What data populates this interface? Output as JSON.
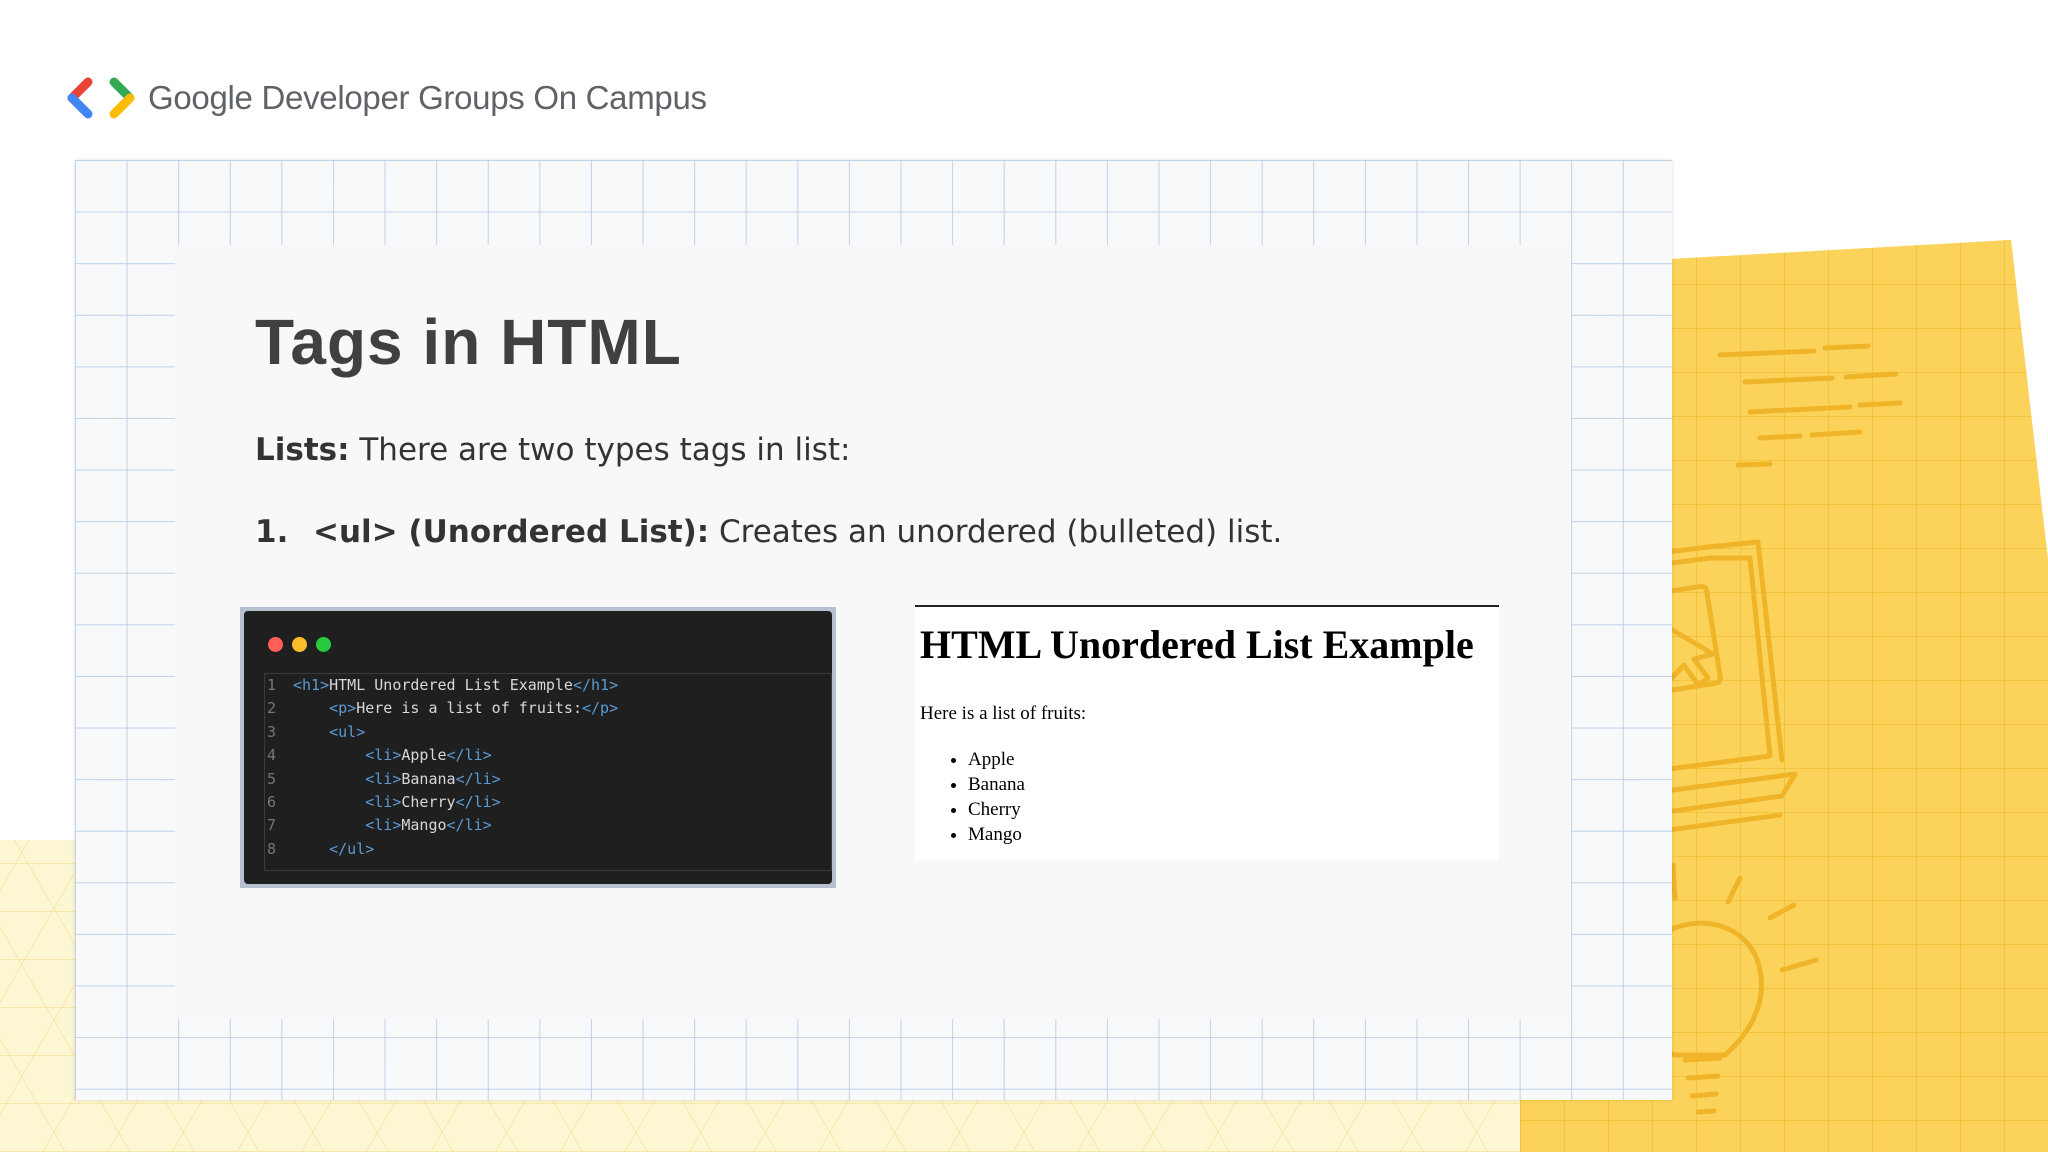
{
  "brand": {
    "name": "Google Developer Groups On Campus",
    "logo_colors": [
      "#ea4335",
      "#4285f4",
      "#34a853",
      "#fbbc04"
    ],
    "logo_icon": "gdg-chevrons-icon"
  },
  "slide": {
    "title": "Tags in HTML",
    "lists_label": "Lists:",
    "lists_text": " There are two types tags in list:",
    "item_number": "1.",
    "item_tag": "<ul> (Unordered List):",
    "item_text": " Creates an unordered (bulleted) list."
  },
  "code_window": {
    "dot_colors": [
      "#ff5f56",
      "#ffbd2e",
      "#27c93f"
    ],
    "lines": [
      {
        "n": "1",
        "indent": "",
        "open": "<h1>",
        "text": "HTML Unordered List Example",
        "close": "</h1>"
      },
      {
        "n": "2",
        "indent": "    ",
        "open": "<p>",
        "text": "Here is a list of fruits:",
        "close": "</p>"
      },
      {
        "n": "3",
        "indent": "    ",
        "open": "<ul>",
        "text": "",
        "close": ""
      },
      {
        "n": "4",
        "indent": "        ",
        "open": "<li>",
        "text": "Apple",
        "close": "</li>"
      },
      {
        "n": "5",
        "indent": "        ",
        "open": "<li>",
        "text": "Banana",
        "close": "</li>"
      },
      {
        "n": "6",
        "indent": "        ",
        "open": "<li>",
        "text": "Cherry",
        "close": "</li>"
      },
      {
        "n": "7",
        "indent": "        ",
        "open": "<li>",
        "text": "Mango",
        "close": "</li>"
      },
      {
        "n": "8",
        "indent": "    ",
        "open": "</ul>",
        "text": "",
        "close": ""
      }
    ]
  },
  "output": {
    "heading": "HTML Unordered List Example",
    "paragraph": "Here is a list of fruits:",
    "items": [
      "Apple",
      "Banana",
      "Cherry",
      "Mango"
    ]
  },
  "decor": {
    "paper_color": "#fcd35a",
    "doodle_color": "#f0b429",
    "doodle_icons": [
      "text-lines-icon",
      "laptop-cursor-icon",
      "lightbulb-icon"
    ]
  }
}
